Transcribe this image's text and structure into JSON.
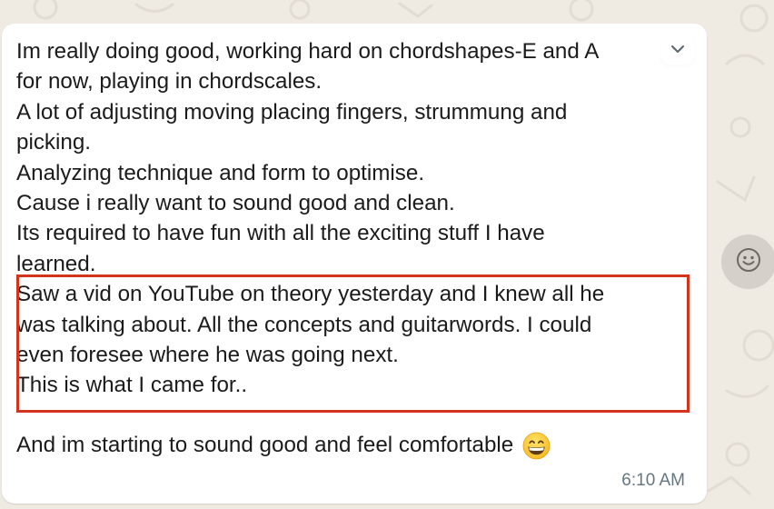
{
  "message": {
    "lines": [
      "Im really doing good, working hard on chordshapes-E and A",
      "for now, playing in chordscales.",
      "A lot of adjusting moving placing fingers, strummung and",
      "picking.",
      "Analyzing technique and form to optimise.",
      "Cause i really want to sound good and clean.",
      "Its required to have fun with all the exciting stuff I have",
      "learned.",
      "Saw a vid on YouTube on theory yesterday and I knew all he",
      "was talking about. All the concepts and guitarwords. I could",
      "even foresee where he was going next.",
      "This is what I came for..",
      "And im starting to sound good and feel comfortable"
    ],
    "emoji": "grinning-face-with-smiling-eyes",
    "time": "6:10 AM"
  },
  "icons": {
    "menu": "chevron-down-icon",
    "reaction": "smiley-icon"
  },
  "colors": {
    "chat_background": "#efeae2",
    "bubble": "#ffffff",
    "text": "#1b1b1b",
    "timestamp": "#667781",
    "highlight": "#d4341d"
  }
}
